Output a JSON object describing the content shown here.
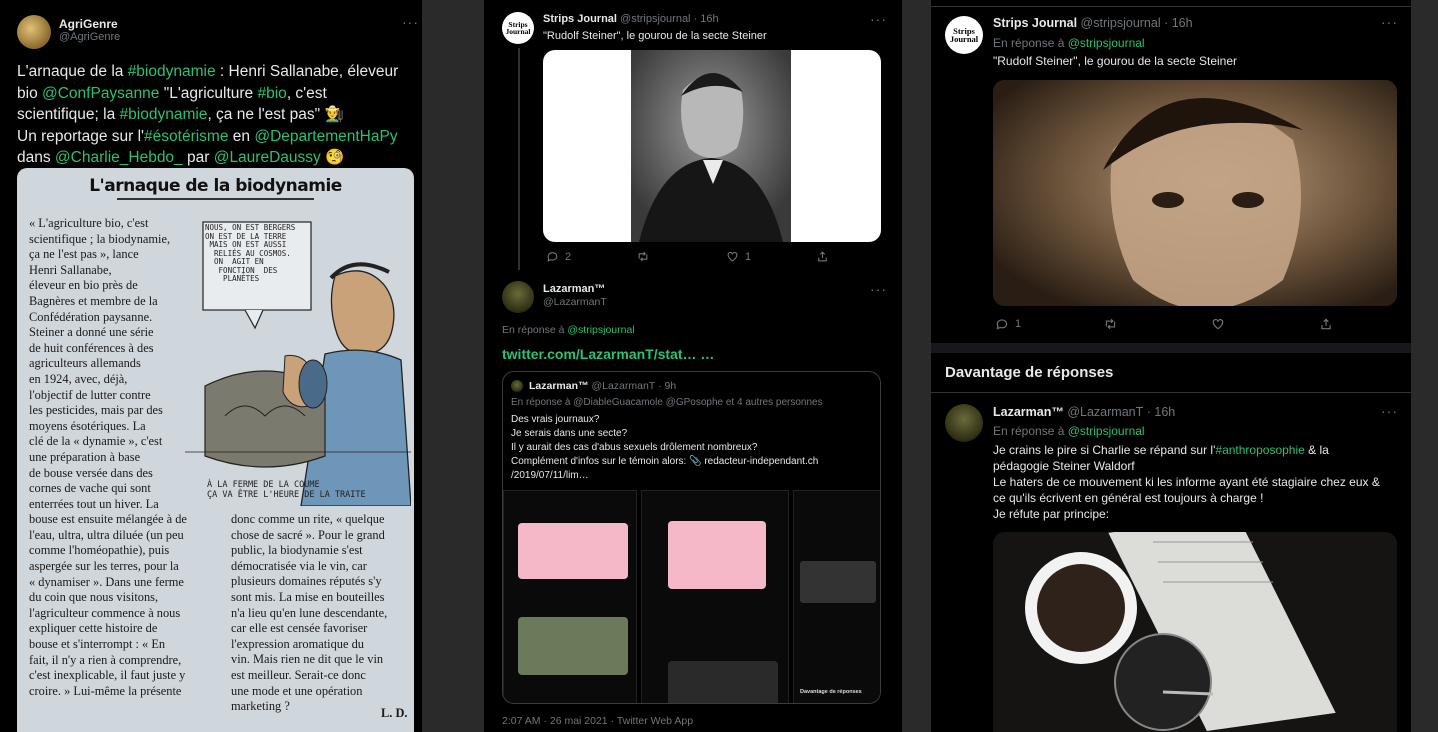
{
  "panel1": {
    "author": "AgriGenre",
    "handle": "@AgriGenre",
    "more": "···",
    "tweet_lines": [
      [
        "L'arnaque de la ",
        "#biodynamie",
        " : Henri Sallanabe, éleveur"
      ],
      [
        "bio ",
        "@ConfPaysanne",
        " \"L'agriculture ",
        "#bio",
        ", c'est"
      ],
      [
        "scientifique; la ",
        "#biodynamie",
        ", ça ne l'est pas\" ",
        "👨‍🌾"
      ],
      [
        "Un reportage sur l'",
        "#ésotérisme",
        " en ",
        "@DepartementHaPy"
      ],
      [
        "dans ",
        "@Charlie_Hebdo_",
        " par ",
        "@LaureDaussy",
        " ",
        "🧐"
      ]
    ],
    "clipping": {
      "title": "L'arnaque de la biodynamie",
      "col1": "« L'agriculture bio, c'est\nscientifique ; la biodynamie,\nça ne l'est pas », lance\nHenri Sallanabe,\néleveur en bio près de\nBagnères et membre de la\nConfédération paysanne.\nSteiner a donné une série\nde huit conférences à des\nagriculteurs allemands\nen 1924, avec, déjà,\nl'objectif de lutter contre\nles pesticides, mais par des\nmoyens ésotériques. La\nclé de la « dynamie », c'est\nune préparation à base\nde bouse versée dans des\ncornes de vache qui sont\nenterrées tout un hiver. La\nbouse est ensuite mélangée à de\nl'eau, ultra, ultra diluée (un peu\ncomme l'homéopathie), puis\naspergée sur les terres, pour la\n« dynamiser ». Dans une ferme\ndu coin que nous visitons,\nl'agriculteur commence à nous\nexpliquer cette histoire de\nbouse et s'interrompt : « En\nfait, il n'y a rien à comprendre,\nc'est inexplicable, il faut juste y\ncroire. » Lui-même la présente",
      "col2": "donc comme un rite, « quelque\nchose de sacré ». Pour le grand\npublic, la biodynamie s'est\ndémocratisée via le vin, car\nplusieurs domaines réputés s'y\nsont mis. La mise en bouteilles\nn'a lieu qu'en lune descendante,\ncar elle est censée favoriser\nl'expression aromatique du\nvin. Mais rien ne dit que le vin\nest meilleur. Serait-ce donc\nune mode et une opération\nmarketing ?",
      "signature": "L. D.",
      "bubble": "NOUS, ON EST BERGERS\nON EST DE LA TERRE\n MAIS ON EST AUSSI\n  RELIÉS AU COSMOS.\n  ON  AGIT EN\n   FONCTION  DES\n    PLANÈTES",
      "caption": "À LA FERME DE LA COUME\nÇA VA ÊTRE L'HEURE DE LA TRAITE"
    }
  },
  "panel2": {
    "tweet1": {
      "author": "Strips Journal",
      "handle": "@stripsjournal",
      "time": "· 16h",
      "text": "\"Rudolf Steiner\", le gourou de la secte Steiner",
      "replies": "2",
      "likes": "1",
      "more": "···"
    },
    "tweet2": {
      "author": "Lazarman™",
      "handle": "@LazarmanT",
      "more": "···",
      "reply_prefix": "En réponse à ",
      "reply_to": "@stripsjournal",
      "link": "twitter.com/LazarmanT/stat… …",
      "quote": {
        "author": "Lazarman™",
        "handle": "@LazarmanT",
        "time": "· 9h",
        "reply_prefix": "En réponse à ",
        "reply_to": "@DiableGuacamole @GPosophe",
        "reply_suffix": " et 4 autres personnes",
        "lines": [
          "Des vrais journaux?",
          "Je serais dans une secte?",
          "Il y aurait des cas d'abus sexuels drôlement nombreux?",
          "Complément d'infos sur le témoin alors: 📎 redacteur-independant.ch",
          "/2019/07/11/lim…"
        ],
        "thumb_labels": [
          "Davantage de réponses"
        ]
      },
      "meta": "2:07 AM · 26 mai 2021 · Twitter Web App"
    }
  },
  "panel3": {
    "tweet1": {
      "author": "Strips Journal",
      "handle": "@stripsjournal",
      "time": "· 16h",
      "reply_prefix": "En réponse à ",
      "reply_to": "@stripsjournal",
      "text": "\"Rudolf Steiner\", le gourou de la secte Steiner",
      "replies": "1",
      "more": "···"
    },
    "section_title": "Davantage de réponses",
    "tweet2": {
      "author": "Lazarman™",
      "handle": "@LazarmanT",
      "time": "· 16h",
      "more": "···",
      "reply_prefix": "En réponse à ",
      "reply_to": "@stripsjournal",
      "line1_pre": "Je crains le pire si Charlie se répand sur l'",
      "line1_tag": "#anthroposophie",
      "line1_post": " & la",
      "lines": [
        "pédagogie Steiner Waldorf",
        "Le haters de ce mouvement ki les informe ayant été stagiaire chez eux &",
        "ce qu'ils écrivent en général est toujours à charge !",
        "Je réfute par principe:"
      ]
    }
  },
  "colors": {
    "accent": "#1d9bf0",
    "green_link": "#2fbf71",
    "background": "#000000",
    "muted": "#71767b"
  },
  "icons": [
    "reply-icon",
    "retweet-icon",
    "like-icon",
    "share-icon",
    "link-icon",
    "more-icon"
  ]
}
